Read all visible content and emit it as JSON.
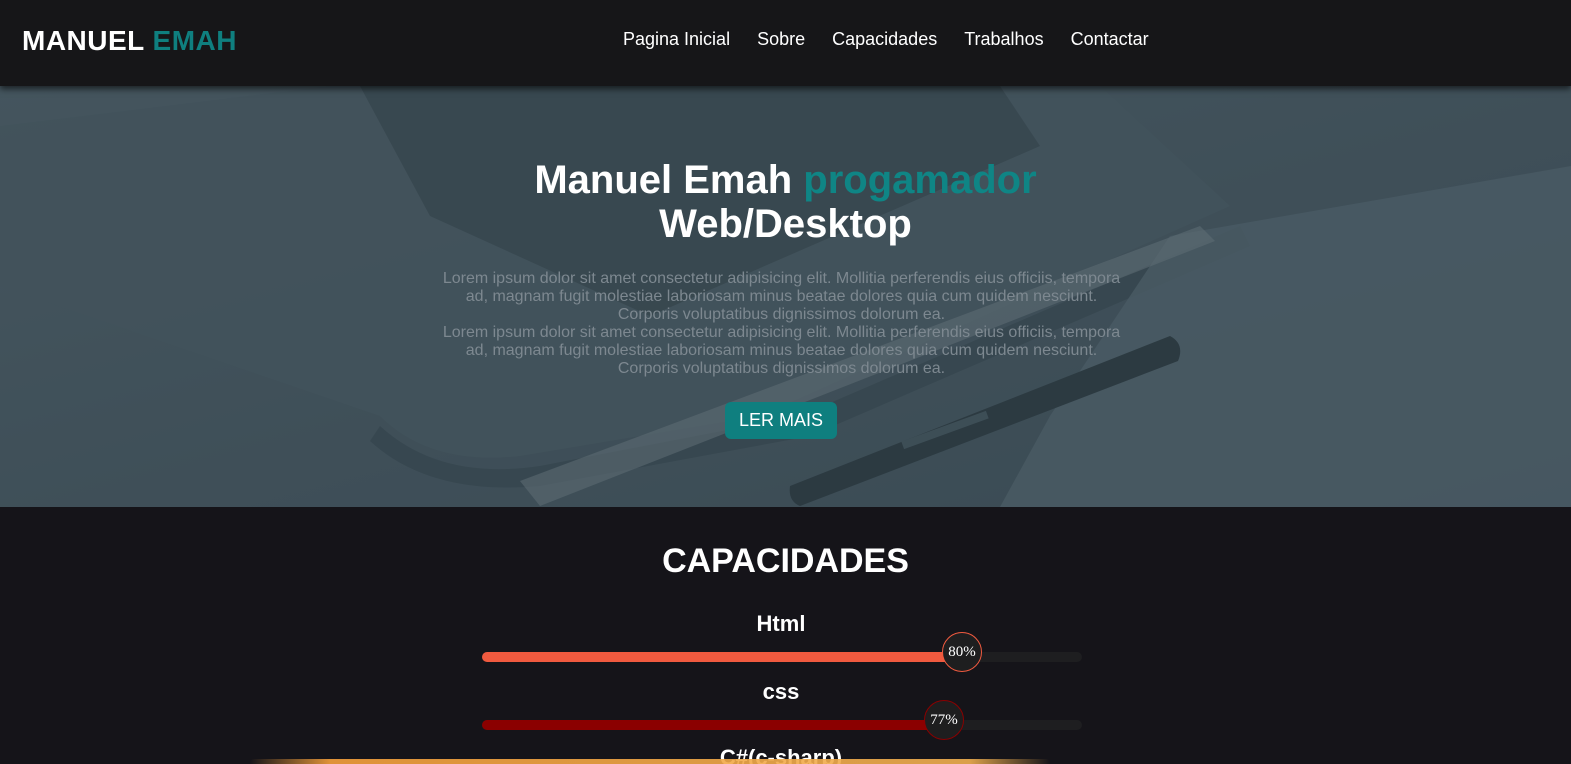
{
  "nav": {
    "logo_main": "MANUEL",
    "logo_accent": "EMAH",
    "links": [
      "Pagina Inicial",
      "Sobre",
      "Capacidades",
      "Trabalhos",
      "Contactar"
    ]
  },
  "hero": {
    "title_a": "Manuel Emah",
    "title_accent": "progamador",
    "title_b": "Web/Desktop",
    "paragraph_1": "Lorem ipsum dolor sit amet consectetur adipisicing elit. Mollitia perferendis eius officiis, tempora ad, magnam fugit molestiae laboriosam minus beatae dolores quia cum quidem nesciunt. Corporis voluptatibus dignissimos dolorum ea.",
    "paragraph_2": "Lorem ipsum dolor sit amet consectetur adipisicing elit. Mollitia perferendis eius officiis, tempora ad, magnam fugit molestiae laboriosam minus beatae dolores quia cum quidem nesciunt. Corporis voluptatibus dignissimos dolorum ea.",
    "button": "LER MAIS"
  },
  "skills": {
    "title": "CAPACIDADES",
    "items": [
      {
        "name": "Html",
        "percent": 80,
        "label": "80%",
        "color": "#f05a3f"
      },
      {
        "name": "css",
        "percent": 77,
        "label": "77%",
        "color": "#8b0000"
      },
      {
        "name": "C#(c-sharp)"
      }
    ]
  },
  "colors": {
    "accent": "#0f7f7f",
    "navbar": "#161618",
    "background": "#151419"
  }
}
